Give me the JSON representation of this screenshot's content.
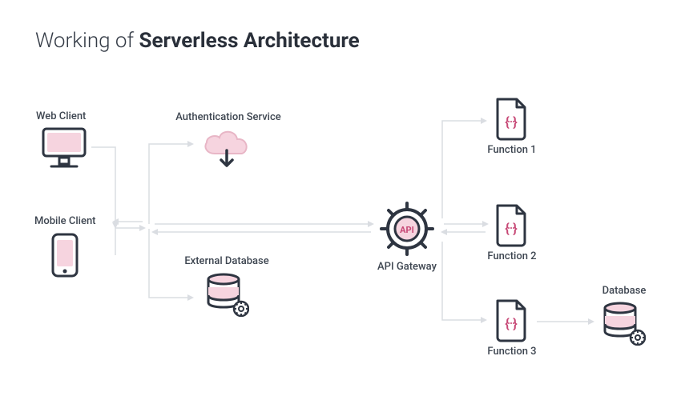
{
  "title_prefix": "Working of ",
  "title_bold": "Serverless Architecture",
  "nodes": {
    "web_client": "Web Client",
    "mobile_client": "Mobile Client",
    "auth_service": "Authentication Service",
    "external_db": "External Database",
    "api_gateway": "API Gateway",
    "api_badge": "API",
    "fn1": "Function 1",
    "fn2": "Function 2",
    "fn3": "Function 3",
    "database": "Database"
  },
  "colors": {
    "outline": "#2e3541",
    "accent": "#f6d4df",
    "accent_stroke": "#e8b6c6",
    "text": "#3e4651",
    "arrow": "#dadde2"
  }
}
